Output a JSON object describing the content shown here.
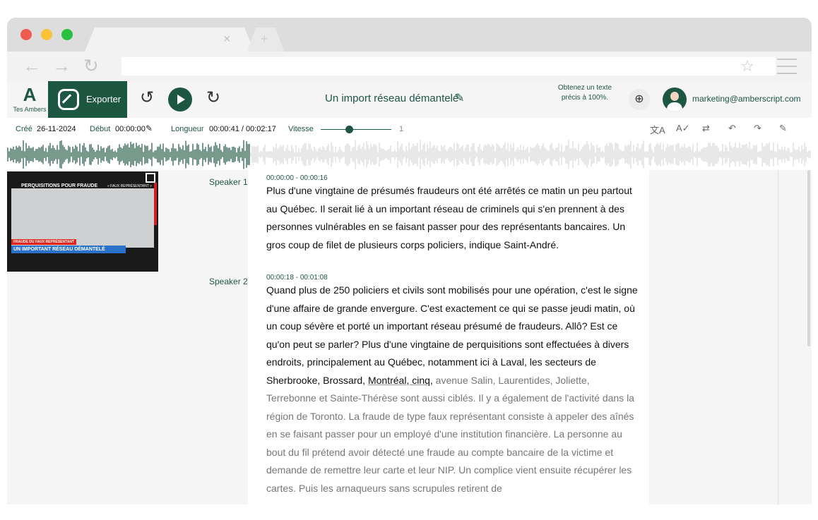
{
  "browser": {
    "tab_close": "×",
    "tab_new": "+",
    "back": "←",
    "forward": "→",
    "reload": "↻",
    "bookmark": "☆"
  },
  "app": {
    "logo_letter": "A",
    "logo_text": "Tes Ambers",
    "export_label": "Exporter",
    "rewind_glyph": "↺",
    "forward_glyph": "↻",
    "title": "Un import réseau démantelé",
    "promo": "Obtenez un texte précis à 100%.",
    "email": "marketing@amberscript.com",
    "brand_color": "#1e5741"
  },
  "meta": {
    "created_label": "Créé",
    "created_value": "26-11-2024",
    "start_label": "Début",
    "start_value": "00:00:00",
    "length_label": "Longueur",
    "length_value": "00:00:41 / 00:02:17",
    "speed_label": "Vitesse",
    "speed_value": "1"
  },
  "video": {
    "headline": "PERQUISITIONS POUR FRAUDE",
    "tag": "« FAUX REPRÉSENTANT »",
    "banner_small": "FRAUDE DU FAUX REPRÉSENTANT",
    "banner_big": "UN IMPORTANT RÉSEAU DÉMANTELÉ"
  },
  "segments": [
    {
      "speaker": "Speaker 1",
      "time": "00:00:00 - 00:00:16",
      "text": "Plus d'une vingtaine de présumés fraudeurs ont été arrêtés ce matin un peu partout au Québec. Il serait lié à un important réseau de criminels qui s'en prennent à des personnes vulnérables en se faisant passer pour des représentants bancaires. Un gros coup de filet de plusieurs corps policiers, indique Saint-André."
    },
    {
      "speaker": "Speaker 2",
      "time": "00:00:18 - 00:01:08",
      "text_played": "Quand plus de 250 policiers et civils sont mobilisés pour une opération, c'est le signe d'une affaire de grande envergure. C'est exactement ce qui se passe jeudi matin, où un coup sévère et porté un important réseau présumé de fraudeurs. Allô? Est ce qu'on peut se parler? Plus d'une vingtaine de perquisitions sont effectuées à divers endroits, principalement au Québec, notamment ici à Laval, les secteurs de Sherbrooke, Brossard, ",
      "text_current": "Montréal, cinq,",
      "text_rest": " avenue Salin, Laurentides, Joliette, Terrebonne et Sainte-Thérèse sont aussi ciblés. Il y a également de l'activité dans la région de Toronto. La fraude de type faux représentant consiste à appeler des aînés en se faisant passer pour un employé d'une institution financière. La personne au bout du fil prétend avoir détecté une fraude au compte bancaire de la victime et demande de remettre leur carte et leur NIP. Un complice vient ensuite récupérer les cartes. Puis les arnaqueurs sans scrupules retirent de"
    }
  ]
}
